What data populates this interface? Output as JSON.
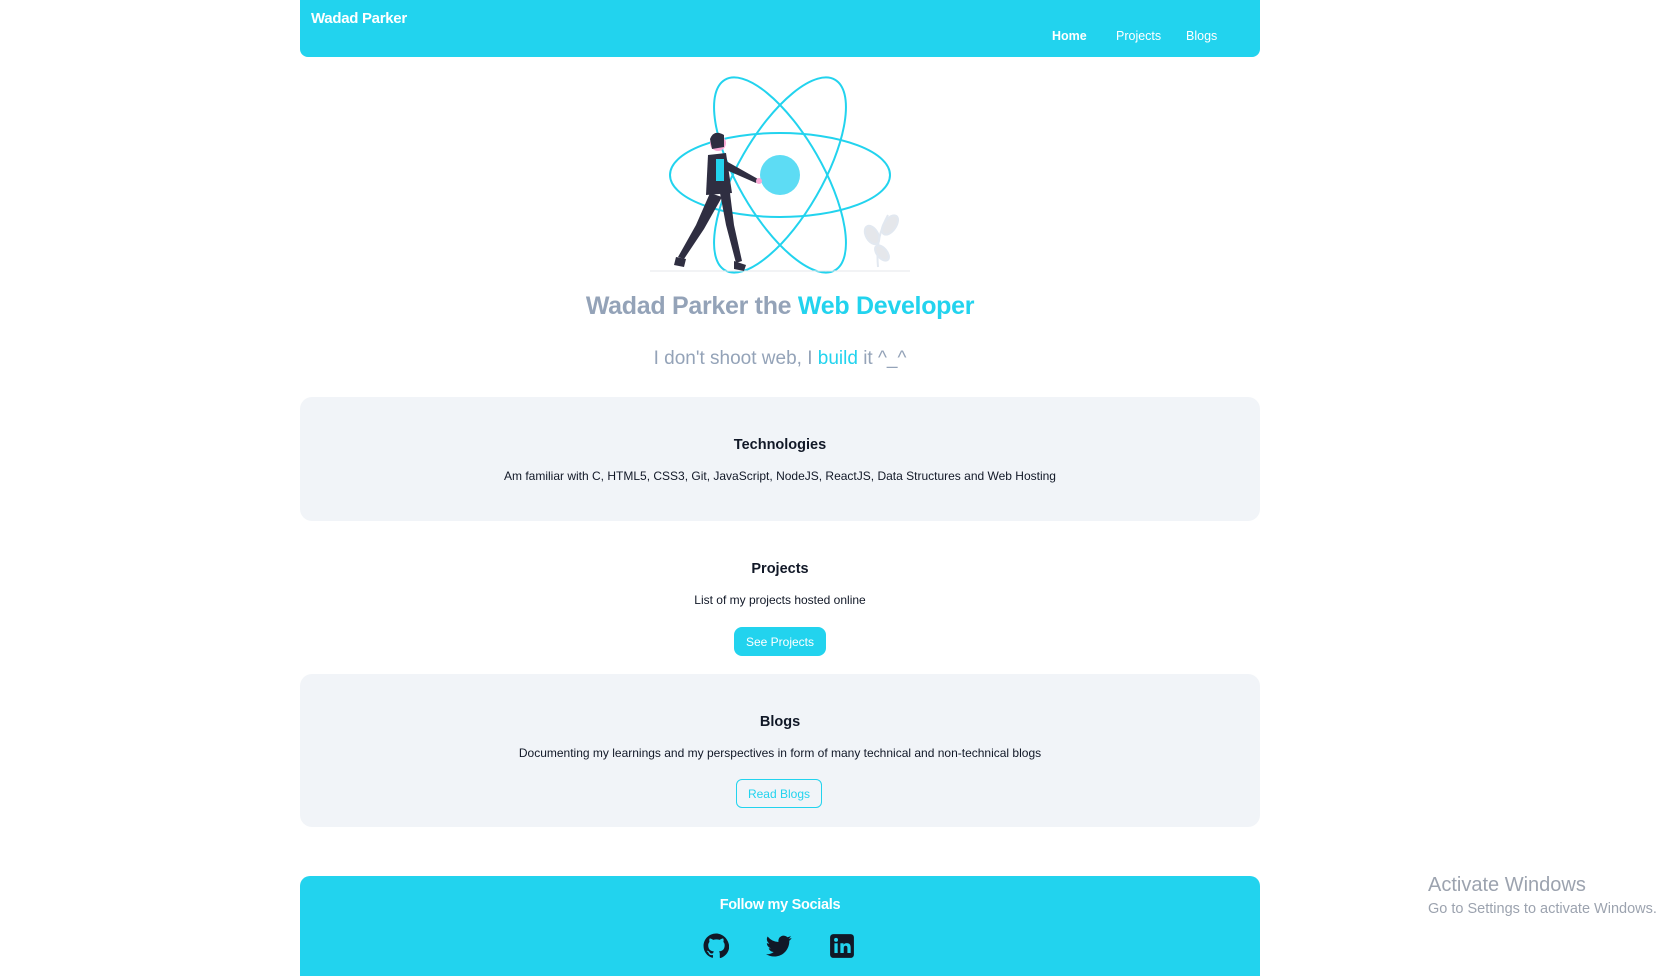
{
  "navbar": {
    "brand": "Wadad Parker",
    "links": [
      {
        "label": "Home",
        "active": true
      },
      {
        "label": "Projects",
        "active": false
      },
      {
        "label": "Blogs",
        "active": false
      }
    ]
  },
  "hero": {
    "title_prefix": "Wadad Parker the ",
    "title_accent": "Web Developer",
    "subtitle_prefix": "I don't shoot web, I ",
    "subtitle_accent": "build",
    "subtitle_suffix": " it ^_^"
  },
  "technologies": {
    "title": "Technologies",
    "text": "Am familiar with C, HTML5, CSS3, Git, JavaScript, NodeJS, ReactJS, Data Structures and Web Hosting"
  },
  "projects": {
    "title": "Projects",
    "text": "List of my projects hosted online",
    "button": "See Projects"
  },
  "blogs": {
    "title": "Blogs",
    "text": "Documenting my learnings and my perspectives in form of many technical and non-technical blogs",
    "button": "Read Blogs"
  },
  "footer": {
    "title": "Follow my Socials",
    "socials": [
      "github-icon",
      "twitter-icon",
      "linkedin-icon"
    ]
  },
  "watermark": {
    "line1": "Activate Windows",
    "line2": "Go to Settings to activate Windows."
  },
  "colors": {
    "accent": "#22d3ee",
    "muted": "#94a3b8",
    "card": "#f1f4f8"
  }
}
